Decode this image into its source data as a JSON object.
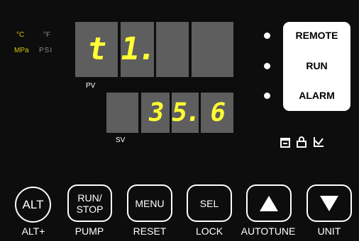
{
  "units": {
    "celsius": "°C",
    "fahrenheit": "°F",
    "mpa": "MPa",
    "psi": "PSI"
  },
  "pv": {
    "label": "PV",
    "digits": [
      "t",
      "1.",
      "",
      ""
    ]
  },
  "sv": {
    "label": "SV",
    "digits": [
      "",
      "3",
      "5.",
      "6"
    ]
  },
  "status": {
    "remote": "REMOTE",
    "run": "RUN",
    "alarm": "ALARM"
  },
  "status_icons": [
    "save-icon",
    "lock-icon",
    "trend-icon"
  ],
  "buttons": {
    "alt": "ALT",
    "run_stop_line1": "RUN/",
    "run_stop_line2": "STOP",
    "menu": "MENU",
    "sel": "SEL"
  },
  "bottom_labels": {
    "alt_plus": "ALT+",
    "pump": "PUMP",
    "reset": "RESET",
    "lock": "LOCK",
    "autotune": "AUTOTUNE",
    "unit": "UNIT"
  },
  "colors": {
    "display_text": "#ffff33",
    "active_unit": "#d8c400",
    "inactive_unit": "#8a8a8a",
    "digit_bg": "#5e5e5e",
    "panel_bg": "#0d0d0d"
  }
}
